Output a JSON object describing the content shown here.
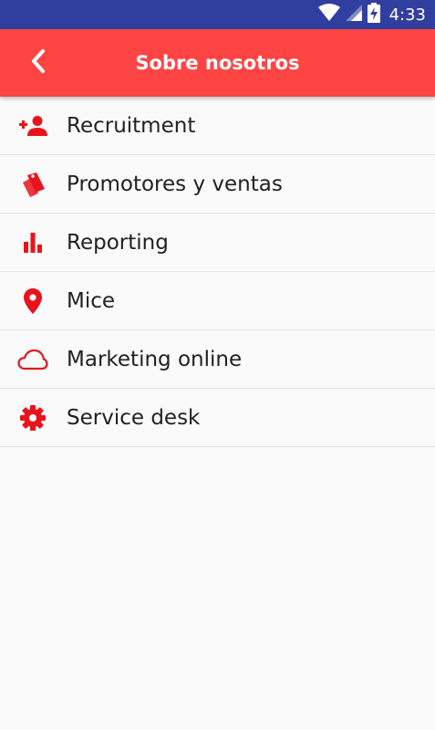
{
  "status_bar": {
    "time": "4:33",
    "background": "#303f9f",
    "icons": [
      "wifi-icon",
      "signal-icon",
      "battery-charging-icon"
    ]
  },
  "app_bar": {
    "title": "Sobre nosotros",
    "background": "#ff4444",
    "back_icon": "chevron-left-icon"
  },
  "menu": {
    "accent": "#e8141c",
    "items": [
      {
        "label": "Recruitment",
        "icon": "person-add-icon"
      },
      {
        "label": "Promotores y ventas",
        "icon": "tags-icon"
      },
      {
        "label": "Reporting",
        "icon": "bar-chart-icon"
      },
      {
        "label": "Mice",
        "icon": "location-pin-icon"
      },
      {
        "label": "Marketing online",
        "icon": "cloud-icon"
      },
      {
        "label": "Service desk",
        "icon": "gear-icon"
      }
    ]
  }
}
